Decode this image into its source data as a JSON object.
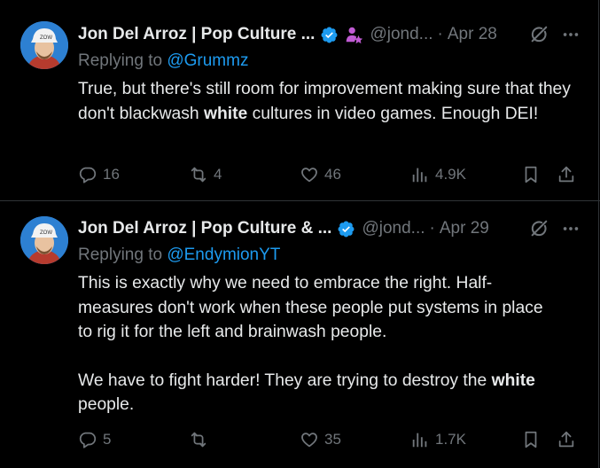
{
  "tweets": [
    {
      "author_name": "Jon Del Arroz | Pop Culture ...",
      "handle": "@jond...",
      "separator": "·",
      "date": "Apr 28",
      "replying_prefix": "Replying to ",
      "replying_to": "@Grummz",
      "body_parts": [
        {
          "t": "True, but there's still room for improvement making sure that they don't blackwash "
        },
        {
          "b": "white"
        },
        {
          "t": " cultures in video games. Enough DEI!"
        }
      ],
      "replies": "16",
      "reposts": "4",
      "likes": "46",
      "views": "4.9K"
    },
    {
      "author_name": "Jon Del Arroz | Pop Culture & ...",
      "handle": "@jond...",
      "separator": "·",
      "date": "Apr 29",
      "replying_prefix": "Replying to ",
      "replying_to": "@EndymionYT",
      "para1": "This is exactly why we need to embrace the right. Half-measures don't work when these people put systems in place to rig it for the left and brainwash people.",
      "para2_a": "We have to fight harder! They are trying to destroy the ",
      "para2_b": "white",
      "para2_c": " people.",
      "replies": "5",
      "reposts": "",
      "likes": "35",
      "views": "1.7K"
    }
  ],
  "colors": {
    "background": "#000000",
    "text": "#e7e9ea",
    "secondary": "#71767b",
    "link": "#1d9bf0",
    "verified": "#1d9bf0",
    "affiliate": "#c05bd3",
    "divider": "#2f3336"
  },
  "icons": [
    "verified-badge-icon",
    "affiliate-badge-icon",
    "grok-icon",
    "more-icon",
    "reply-icon",
    "repost-icon",
    "like-icon",
    "views-icon",
    "bookmark-icon",
    "share-icon"
  ]
}
